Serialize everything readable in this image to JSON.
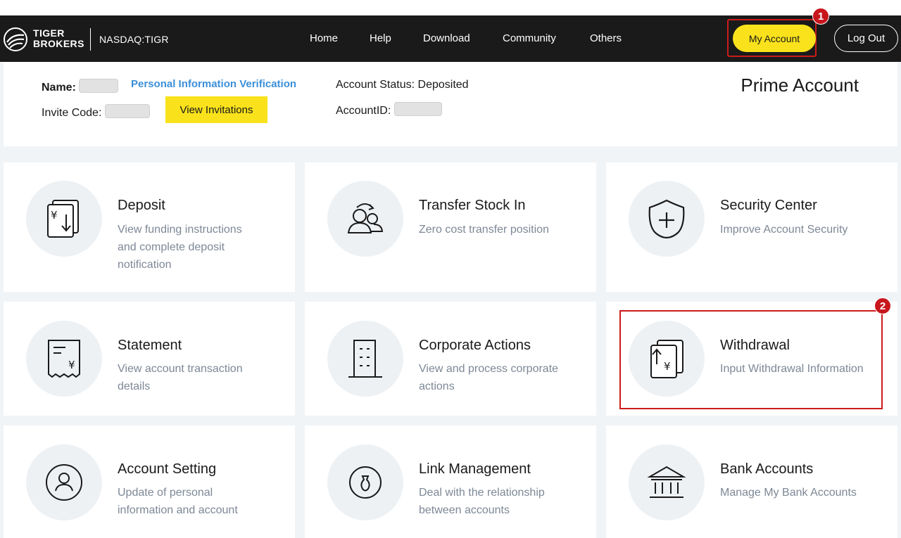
{
  "header": {
    "brand_line1": "TIGER",
    "brand_line2": "BROKERS",
    "ticker": "NASDAQ:TIGR",
    "nav": [
      "Home",
      "Help",
      "Download",
      "Community",
      "Others"
    ],
    "my_account": "My Account",
    "logout": "Log Out"
  },
  "badges": [
    "1",
    "2"
  ],
  "info": {
    "name_label": "Name:",
    "verify_link": "Personal Information Verification",
    "invite_label": "Invite Code:",
    "invite_button": "View Invitations",
    "status": "Account Status: Deposited",
    "account_id_label": "AccountID:",
    "account_type": "Prime Account"
  },
  "cards": [
    {
      "title": "Deposit",
      "desc": [
        "View funding instructions",
        "and complete deposit",
        "notification"
      ],
      "icon": "deposit-icon"
    },
    {
      "title": "Transfer Stock In",
      "desc": [
        "Zero cost transfer position"
      ],
      "icon": "transfer-icon"
    },
    {
      "title": "Security Center",
      "desc": [
        "Improve Account Security"
      ],
      "icon": "shield-plus-icon"
    },
    {
      "title": "Statement",
      "desc": [
        "View account transaction",
        "details"
      ],
      "icon": "receipt-icon"
    },
    {
      "title": "Corporate Actions",
      "desc": [
        "View and process corporate",
        "actions"
      ],
      "icon": "building-icon"
    },
    {
      "title": "Withdrawal",
      "desc": [
        "Input Withdrawal Information"
      ],
      "icon": "withdraw-icon"
    },
    {
      "title": "Account Setting",
      "desc": [
        "Update of personal",
        "information and account"
      ],
      "icon": "user-circle-icon"
    },
    {
      "title": "Link Management",
      "desc": [
        "Deal with the relationship",
        "between accounts"
      ],
      "icon": "link-icon"
    },
    {
      "title": "Bank Accounts",
      "desc": [
        "Manage My Bank Accounts"
      ],
      "icon": "bank-icon"
    }
  ]
}
